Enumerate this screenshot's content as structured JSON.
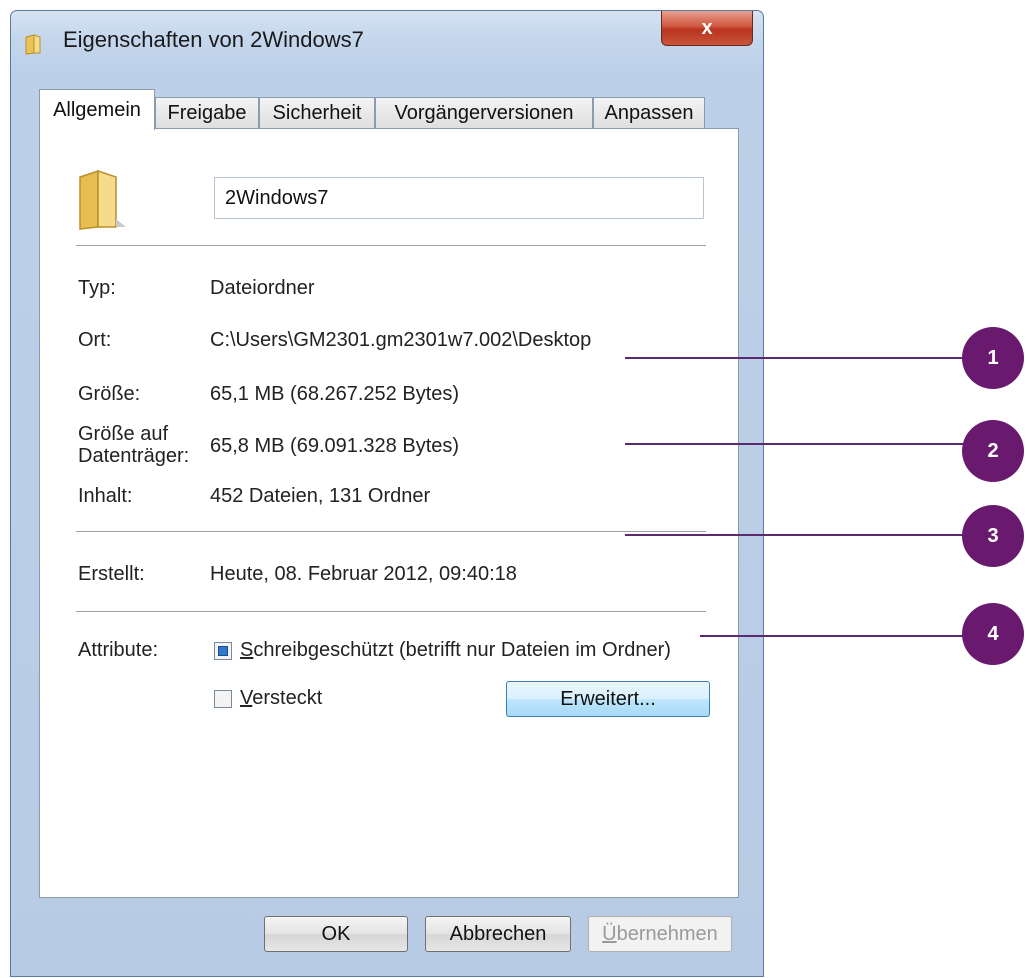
{
  "window": {
    "title": "Eigenschaften von 2Windows7",
    "close_label": "x"
  },
  "tabs": [
    {
      "label": "Allgemein"
    },
    {
      "label": "Freigabe"
    },
    {
      "label": "Sicherheit"
    },
    {
      "label": "Vorgängerversionen"
    },
    {
      "label": "Anpassen"
    }
  ],
  "general": {
    "folder_name": "2Windows7",
    "type_label": "Typ:",
    "type_value": "Dateiordner",
    "location_label": "Ort:",
    "location_value": "C:\\Users\\GM2301.gm2301w7.002\\Desktop",
    "size_label": "Größe:",
    "size_value": "65,1 MB (68.267.252 Bytes)",
    "disk_size_label_1": "Größe auf",
    "disk_size_label_2": "Datenträger:",
    "disk_size_value": "65,8 MB (69.091.328 Bytes)",
    "contents_label": "Inhalt:",
    "contents_value": "452 Dateien, 131 Ordner",
    "created_label": "Erstellt:",
    "created_value": "Heute, 08. Februar 2012, 09:40:18",
    "attributes_label": "Attribute:",
    "readonly_label_u": "S",
    "readonly_label_rest": "chreibgeschützt (betrifft nur Dateien im Ordner)",
    "hidden_label_u": "V",
    "hidden_label_rest": "ersteckt",
    "advanced_button": "Erweitert..."
  },
  "footer": {
    "ok": "OK",
    "cancel": "Abbrechen",
    "apply_u": "Ü",
    "apply_rest": "bernehmen"
  },
  "callouts": [
    "1",
    "2",
    "3",
    "4"
  ],
  "colors": {
    "callout": "#6a1a6e",
    "checkbox_indeterminate": "#2f7ad0"
  }
}
